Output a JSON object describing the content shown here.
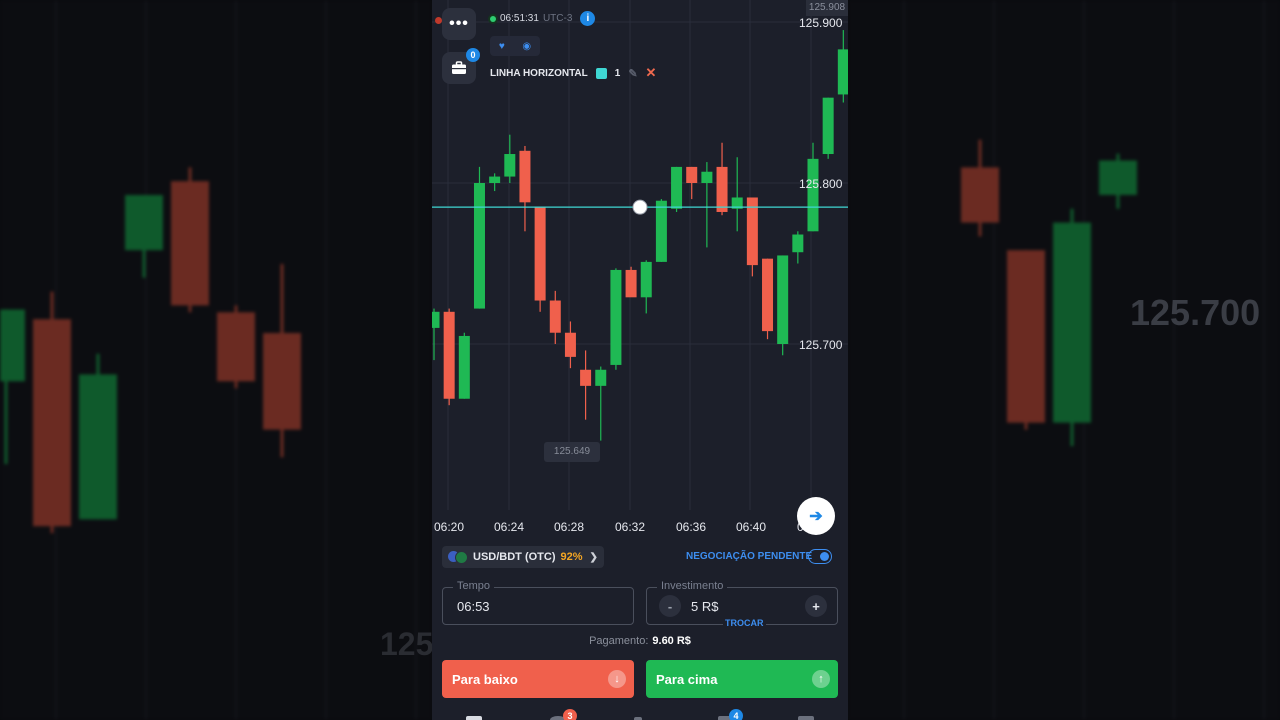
{
  "background": {
    "side_price": "125.700",
    "side_price_left": "125."
  },
  "toolbar": {
    "menu_icon": "ellipsis-icon",
    "portfolio_badge": "0",
    "clock_time": "06:51:31",
    "timezone": "UTC-3",
    "info_label": "i"
  },
  "drawing": {
    "tool_name": "LINHA HORIZONTAL",
    "line_width": "1",
    "line_color": "#3fd7d3"
  },
  "axis": {
    "price_top": "125.908",
    "price_labels": [
      "125.900",
      "125.800",
      "125.700"
    ],
    "low_marker": "125.649",
    "time_labels": [
      "06:20",
      "06:24",
      "06:28",
      "06:32",
      "06:36",
      "06:40",
      "06:"
    ]
  },
  "asset": {
    "pair": "USD/BDT (OTC)",
    "payout_pct": "92%"
  },
  "pending": {
    "label": "NEGOCIAÇÃO PENDENTE",
    "enabled": true
  },
  "time_field": {
    "label": "Tempo",
    "value": "06:53"
  },
  "investment_field": {
    "label": "Investimento",
    "value": "5 R$",
    "minus": "-",
    "plus": "+",
    "swap_label": "TROCAR"
  },
  "payout": {
    "label": "Pagamento:",
    "value": "9.60 R$"
  },
  "buttons": {
    "down_label": "Para baixo",
    "up_label": "Para cima"
  },
  "nav": {
    "badge_1": "3",
    "badge_2": "4"
  },
  "colors": {
    "bull": "#1fb954",
    "bear": "#f0604c",
    "accent": "#3d8ef0"
  },
  "candles": [
    {
      "o": 125.71,
      "h": 125.722,
      "l": 125.69,
      "c": 125.72
    },
    {
      "o": 125.72,
      "h": 125.722,
      "l": 125.662,
      "c": 125.666
    },
    {
      "o": 125.666,
      "h": 125.707,
      "l": 125.666,
      "c": 125.705
    },
    {
      "o": 125.722,
      "h": 125.81,
      "l": 125.722,
      "c": 125.8
    },
    {
      "o": 125.8,
      "h": 125.806,
      "l": 125.795,
      "c": 125.804
    },
    {
      "o": 125.804,
      "h": 125.83,
      "l": 125.8,
      "c": 125.818
    },
    {
      "o": 125.82,
      "h": 125.823,
      "l": 125.77,
      "c": 125.788
    },
    {
      "o": 125.785,
      "h": 125.785,
      "l": 125.72,
      "c": 125.727
    },
    {
      "o": 125.727,
      "h": 125.733,
      "l": 125.7,
      "c": 125.707
    },
    {
      "o": 125.707,
      "h": 125.714,
      "l": 125.685,
      "c": 125.692
    },
    {
      "o": 125.684,
      "h": 125.696,
      "l": 125.653,
      "c": 125.674
    },
    {
      "o": 125.674,
      "h": 125.686,
      "l": 125.64,
      "c": 125.684
    },
    {
      "o": 125.687,
      "h": 125.747,
      "l": 125.684,
      "c": 125.746
    },
    {
      "o": 125.746,
      "h": 125.748,
      "l": 125.73,
      "c": 125.729
    },
    {
      "o": 125.729,
      "h": 125.752,
      "l": 125.719,
      "c": 125.751
    },
    {
      "o": 125.751,
      "h": 125.79,
      "l": 125.751,
      "c": 125.789
    },
    {
      "o": 125.784,
      "h": 125.81,
      "l": 125.782,
      "c": 125.81
    },
    {
      "o": 125.81,
      "h": 125.81,
      "l": 125.79,
      "c": 125.8
    },
    {
      "o": 125.8,
      "h": 125.813,
      "l": 125.76,
      "c": 125.807
    },
    {
      "o": 125.81,
      "h": 125.825,
      "l": 125.78,
      "c": 125.782
    },
    {
      "o": 125.784,
      "h": 125.816,
      "l": 125.77,
      "c": 125.791
    },
    {
      "o": 125.791,
      "h": 125.791,
      "l": 125.742,
      "c": 125.749
    },
    {
      "o": 125.753,
      "h": 125.753,
      "l": 125.703,
      "c": 125.708
    },
    {
      "o": 125.7,
      "h": 125.755,
      "l": 125.693,
      "c": 125.755
    },
    {
      "o": 125.757,
      "h": 125.77,
      "l": 125.75,
      "c": 125.768
    },
    {
      "o": 125.77,
      "h": 125.825,
      "l": 125.77,
      "c": 125.815
    },
    {
      "o": 125.818,
      "h": 125.853,
      "l": 125.815,
      "c": 125.853
    },
    {
      "o": 125.855,
      "h": 125.895,
      "l": 125.85,
      "c": 125.883
    }
  ],
  "horizontal_line_price": 125.785,
  "left_background_candles": [
    {
      "o": 125.765,
      "h": 125.817,
      "l": 125.705,
      "c": 125.817
    },
    {
      "o": 125.81,
      "h": 125.83,
      "l": 125.655,
      "c": 125.66
    },
    {
      "o": 125.665,
      "h": 125.785,
      "l": 125.665,
      "c": 125.77
    },
    {
      "o": 125.86,
      "h": 125.9,
      "l": 125.84,
      "c": 125.9
    },
    {
      "o": 125.91,
      "h": 125.92,
      "l": 125.815,
      "c": 125.82
    },
    {
      "o": 125.815,
      "h": 125.82,
      "l": 125.76,
      "c": 125.765
    },
    {
      "o": 125.8,
      "h": 125.85,
      "l": 125.71,
      "c": 125.73
    }
  ],
  "right_background_candles": [
    {
      "o": 125.92,
      "h": 125.94,
      "l": 125.87,
      "c": 125.88
    },
    {
      "o": 125.86,
      "h": 125.86,
      "l": 125.73,
      "c": 125.735
    },
    {
      "o": 125.735,
      "h": 125.89,
      "l": 125.718,
      "c": 125.88
    },
    {
      "o": 125.9,
      "h": 125.93,
      "l": 125.89,
      "c": 125.925
    }
  ]
}
